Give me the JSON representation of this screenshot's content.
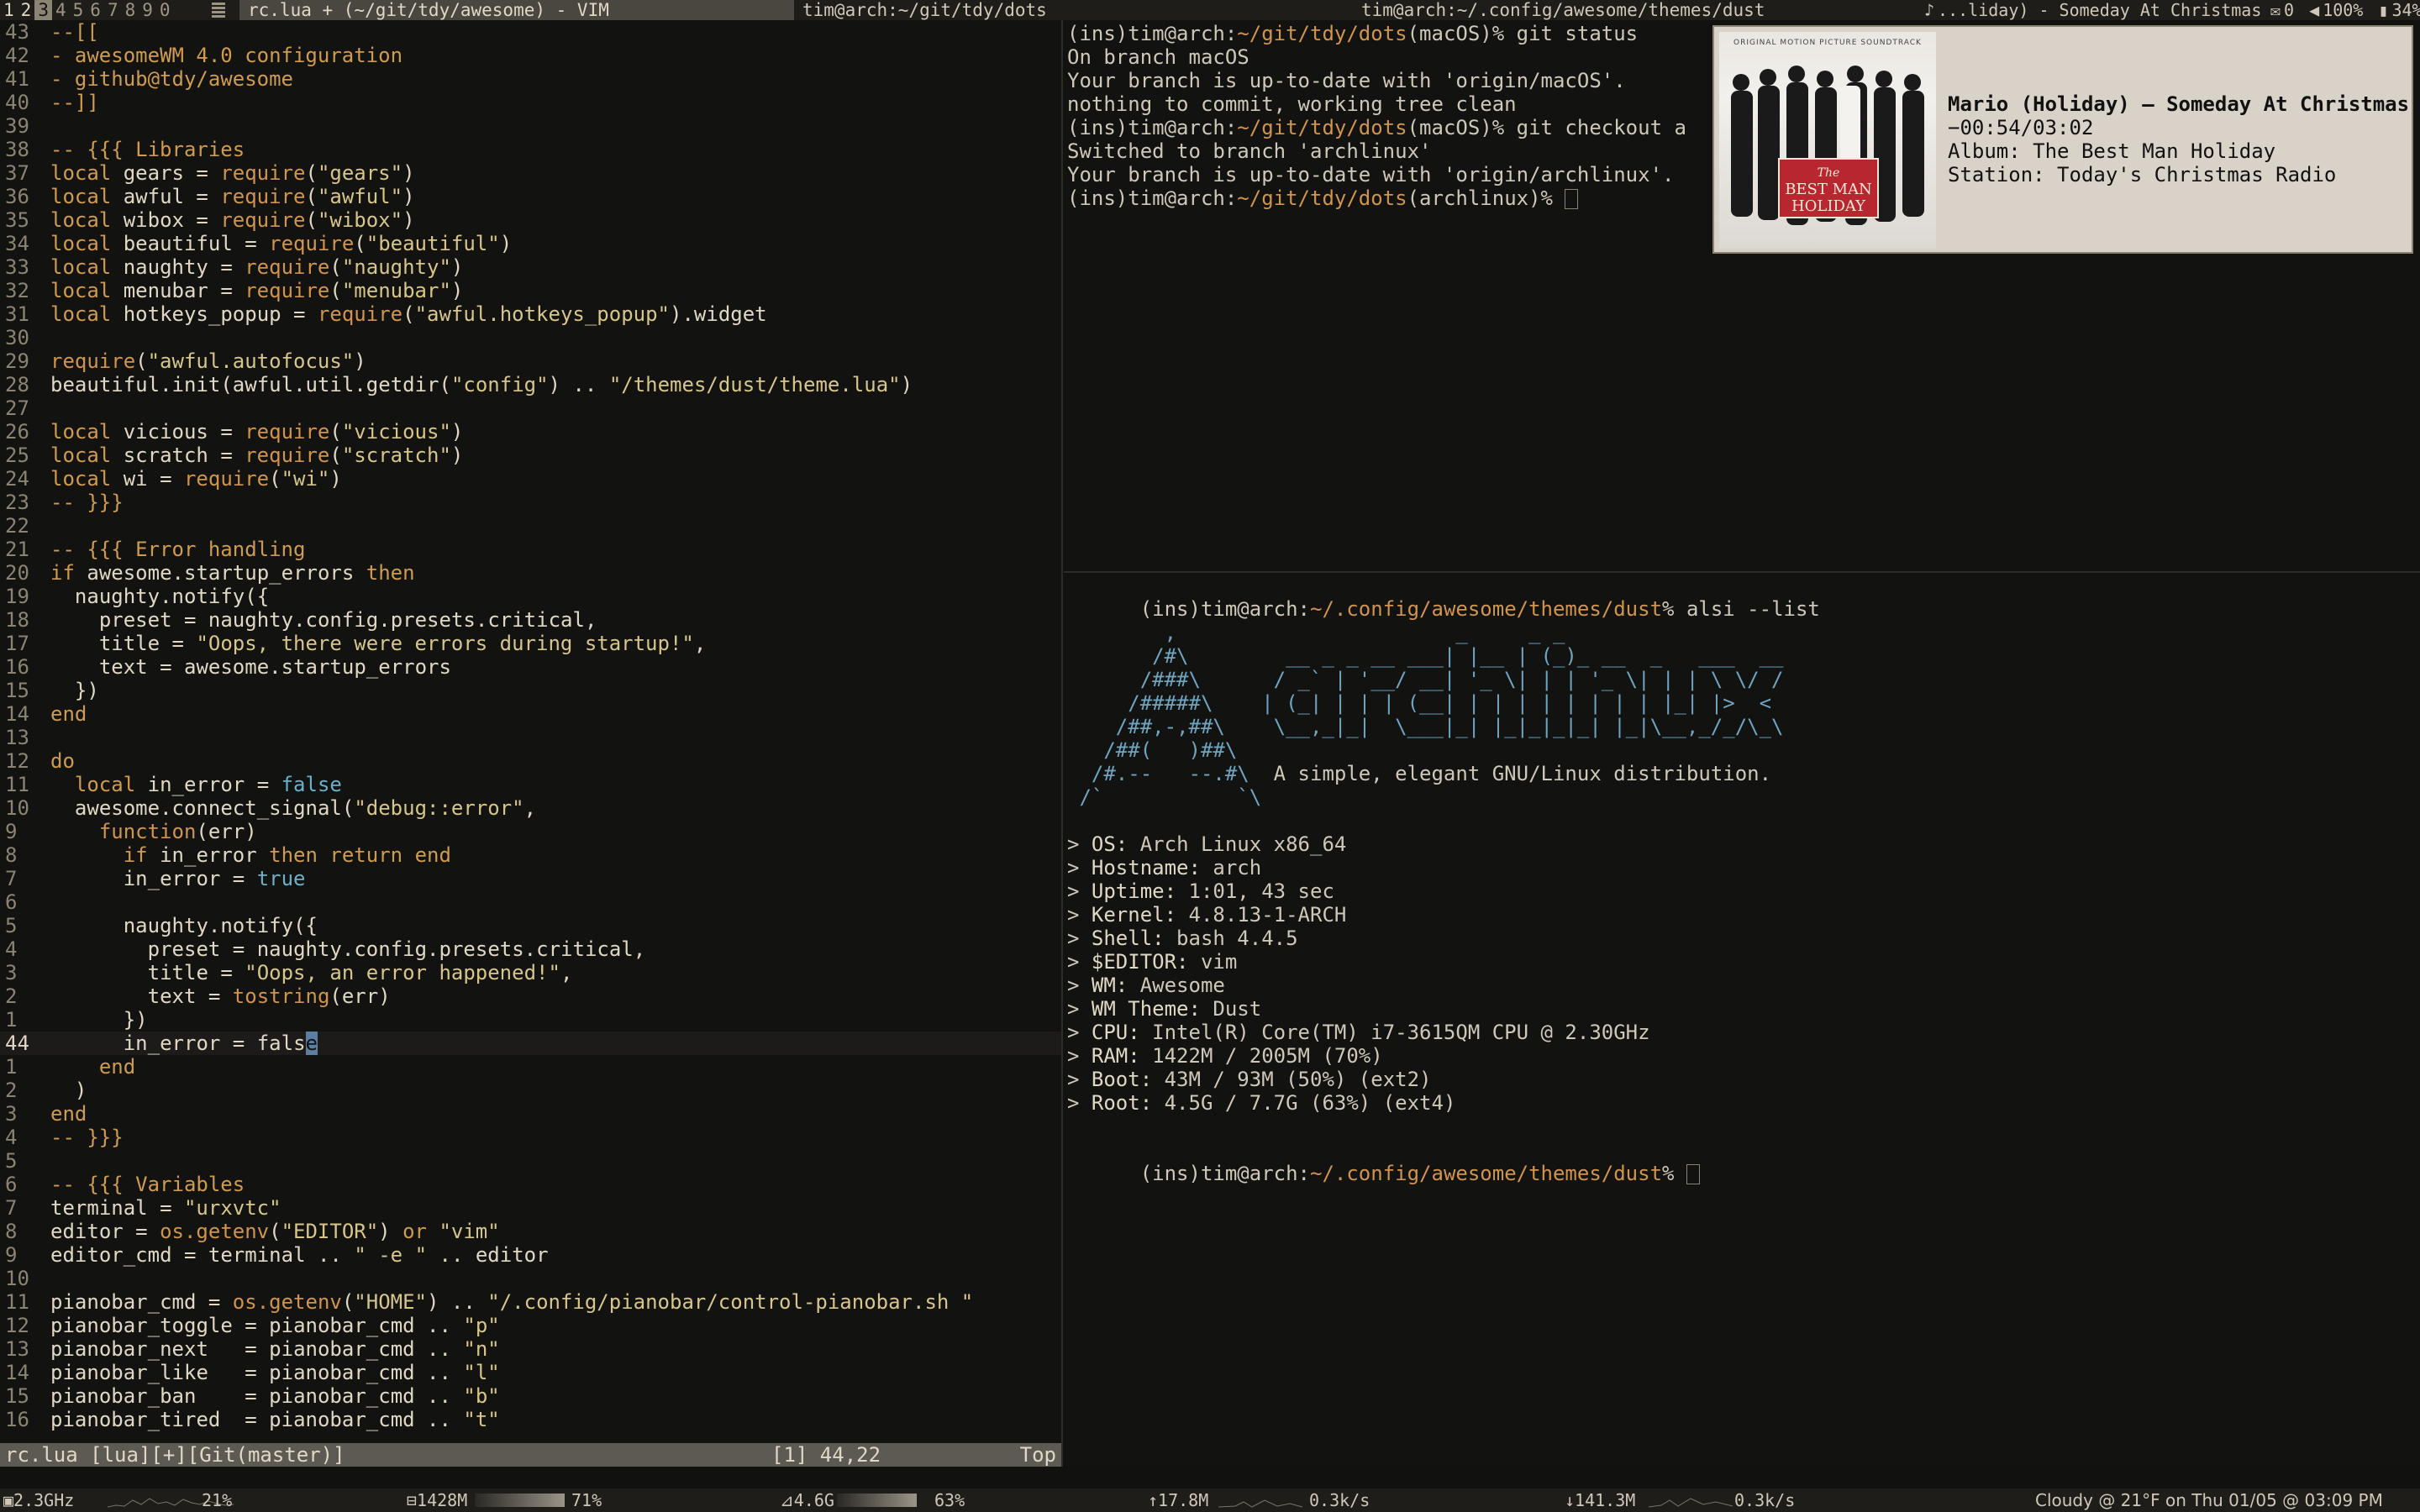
{
  "topbar": {
    "tags": [
      "1",
      "2",
      "3",
      "4",
      "5",
      "6",
      "7",
      "8",
      "9",
      "0"
    ],
    "active_tag": "3",
    "layout_icon": "tile-layout-icon",
    "tasks": [
      {
        "title": "rc.lua + (~/git/tdy/awesome) - VIM",
        "focused": true
      },
      {
        "title": "tim@arch:~/git/tdy/dots",
        "focused": false
      },
      {
        "title": "tim@arch:~/.config/awesome/themes/dust",
        "focused": false
      }
    ],
    "now_playing": "...liday) - Someday At Christmas",
    "mail": "0",
    "volume": "100%",
    "battery": "34%"
  },
  "editor": {
    "lines": [
      {
        "n": "43",
        "t": "--[[",
        "c": "com"
      },
      {
        "n": "42",
        "t": "- awesomeWM 4.0 configuration",
        "c": "com"
      },
      {
        "n": "41",
        "t": "- github@tdy/awesome",
        "c": "com"
      },
      {
        "n": "40",
        "t": "--]]",
        "c": "com"
      },
      {
        "n": "39",
        "t": "",
        "c": "txt"
      },
      {
        "n": "38",
        "t": "-- {{{ Libraries",
        "c": "com"
      },
      {
        "n": "37",
        "t": "local gears = require(\"gears\")",
        "c": "txt"
      },
      {
        "n": "36",
        "t": "local awful = require(\"awful\")",
        "c": "txt"
      },
      {
        "n": "35",
        "t": "local wibox = require(\"wibox\")",
        "c": "txt"
      },
      {
        "n": "34",
        "t": "local beautiful = require(\"beautiful\")",
        "c": "txt"
      },
      {
        "n": "33",
        "t": "local naughty = require(\"naughty\")",
        "c": "txt"
      },
      {
        "n": "32",
        "t": "local menubar = require(\"menubar\")",
        "c": "txt"
      },
      {
        "n": "31",
        "t": "local hotkeys_popup = require(\"awful.hotkeys_popup\").widget",
        "c": "txt"
      },
      {
        "n": "30",
        "t": "",
        "c": "txt"
      },
      {
        "n": "29",
        "t": "require(\"awful.autofocus\")",
        "c": "txt"
      },
      {
        "n": "28",
        "t": "beautiful.init(awful.util.getdir(\"config\") .. \"/themes/dust/theme.lua\")",
        "c": "txt"
      },
      {
        "n": "27",
        "t": "",
        "c": "txt"
      },
      {
        "n": "26",
        "t": "local vicious = require(\"vicious\")",
        "c": "txt"
      },
      {
        "n": "25",
        "t": "local scratch = require(\"scratch\")",
        "c": "txt"
      },
      {
        "n": "24",
        "t": "local wi = require(\"wi\")",
        "c": "txt"
      },
      {
        "n": "23",
        "t": "-- }}}",
        "c": "com"
      },
      {
        "n": "22",
        "t": "",
        "c": "txt"
      },
      {
        "n": "21",
        "t": "-- {{{ Error handling",
        "c": "com"
      },
      {
        "n": "20",
        "t": "if awesome.startup_errors then",
        "c": "txt"
      },
      {
        "n": "19",
        "t": "  naughty.notify({",
        "c": "txt"
      },
      {
        "n": "18",
        "t": "    preset = naughty.config.presets.critical,",
        "c": "txt"
      },
      {
        "n": "17",
        "t": "    title = \"Oops, there were errors during startup!\",",
        "c": "txt"
      },
      {
        "n": "16",
        "t": "    text = awesome.startup_errors",
        "c": "txt"
      },
      {
        "n": "15",
        "t": "  })",
        "c": "txt"
      },
      {
        "n": "14",
        "t": "end",
        "c": "kw"
      },
      {
        "n": "13",
        "t": "",
        "c": "txt"
      },
      {
        "n": "12",
        "t": "do",
        "c": "kw"
      },
      {
        "n": "11",
        "t": "  local in_error = false",
        "c": "txt"
      },
      {
        "n": "10",
        "t": "  awesome.connect_signal(\"debug::error\",",
        "c": "txt"
      },
      {
        "n": "9",
        "t": "    function(err)",
        "c": "txt"
      },
      {
        "n": "8",
        "t": "      if in_error then return end",
        "c": "txt"
      },
      {
        "n": "7",
        "t": "      in_error = true",
        "c": "txt"
      },
      {
        "n": "6",
        "t": "",
        "c": "txt"
      },
      {
        "n": "5",
        "t": "      naughty.notify({",
        "c": "txt"
      },
      {
        "n": "4",
        "t": "        preset = naughty.config.presets.critical,",
        "c": "txt"
      },
      {
        "n": "3",
        "t": "        title = \"Oops, an error happened!\",",
        "c": "txt"
      },
      {
        "n": "2",
        "t": "        text = tostring(err)",
        "c": "txt"
      },
      {
        "n": "1",
        "t": "      })",
        "c": "txt"
      },
      {
        "n": "44",
        "t": "      in_error = fals",
        "c": "txt",
        "current": true,
        "cursor_char": "e"
      },
      {
        "n": "1",
        "t": "    end",
        "c": "kw"
      },
      {
        "n": "2",
        "t": "  )",
        "c": "txt"
      },
      {
        "n": "3",
        "t": "end",
        "c": "kw"
      },
      {
        "n": "4",
        "t": "-- }}}",
        "c": "com"
      },
      {
        "n": "5",
        "t": "",
        "c": "txt"
      },
      {
        "n": "6",
        "t": "-- {{{ Variables",
        "c": "com"
      },
      {
        "n": "7",
        "t": "terminal = \"urxvtc\"",
        "c": "txt"
      },
      {
        "n": "8",
        "t": "editor = os.getenv(\"EDITOR\") or \"vim\"",
        "c": "txt"
      },
      {
        "n": "9",
        "t": "editor_cmd = terminal .. \" -e \" .. editor",
        "c": "txt"
      },
      {
        "n": "10",
        "t": "",
        "c": "txt"
      },
      {
        "n": "11",
        "t": "pianobar_cmd = os.getenv(\"HOME\") .. \"/.config/pianobar/control-pianobar.sh \"",
        "c": "txt"
      },
      {
        "n": "12",
        "t": "pianobar_toggle = pianobar_cmd .. \"p\"",
        "c": "txt"
      },
      {
        "n": "13",
        "t": "pianobar_next   = pianobar_cmd .. \"n\"",
        "c": "txt"
      },
      {
        "n": "14",
        "t": "pianobar_like   = pianobar_cmd .. \"l\"",
        "c": "txt"
      },
      {
        "n": "15",
        "t": "pianobar_ban    = pianobar_cmd .. \"b\"",
        "c": "txt"
      },
      {
        "n": "16",
        "t": "pianobar_tired  = pianobar_cmd .. \"t\"",
        "c": "txt"
      }
    ],
    "statusline_left": "rc.lua [lua][+][Git(master)]",
    "statusline_pos": "[1] 44,22",
    "statusline_scroll": "Top"
  },
  "term1": {
    "lines": [
      {
        "prompt": {
          "ins": "(ins)",
          "user": "tim@arch",
          "sep": ":",
          "path": "~/git/tdy/dots",
          "branch": "(macOS)",
          "sym": "% "
        },
        "cmd": "git status"
      },
      {
        "text": "On branch macOS"
      },
      {
        "text": "Your branch is up-to-date with 'origin/macOS'."
      },
      {
        "text": "nothing to commit, working tree clean"
      },
      {
        "prompt": {
          "ins": "(ins)",
          "user": "tim@arch",
          "sep": ":",
          "path": "~/git/tdy/dots",
          "branch": "(macOS)",
          "sym": "% "
        },
        "cmd": "git checkout a"
      },
      {
        "text": "Switched to branch 'archlinux'"
      },
      {
        "text": "Your branch is up-to-date with 'origin/archlinux'."
      },
      {
        "prompt": {
          "ins": "(ins)",
          "user": "tim@arch",
          "sep": ":",
          "path": "~/git/tdy/dots",
          "branch": "(archlinux)",
          "sym": "% "
        },
        "cmd": "",
        "cursor": true
      }
    ]
  },
  "term2": {
    "prompt1": {
      "ins": "(ins)",
      "user": "tim@arch",
      "sep": ":",
      "path": "~/.config/awesome/themes/dust",
      "sym": "% "
    },
    "cmd1": "alsi --list",
    "ascii_logo": [
      "        ,                       _     _ _",
      "       /#\\        __ _ _ __ ___| |__ | (_)_ __  _   ___  __",
      "      /###\\      / _` | '__/ __| '_ \\| | | '_ \\| | | \\ \\/ /",
      "     /#####\\    | (_| | | | (__| | | | | | | | | |_| |>  <",
      "    /##,-,##\\    \\__,_|_|  \\___|_| |_|_|_|_| |_|\\__,_/_/\\_\\",
      "   /##(   )##\\",
      "  /#.--   --.#\\  A simple, elegant GNU/Linux distribution.",
      " /`           `\\"
    ],
    "info": [
      {
        "k": "OS",
        "v": "Arch Linux x86_64"
      },
      {
        "k": "Hostname",
        "v": "arch"
      },
      {
        "k": "Uptime",
        "v": "1:01, 43 sec"
      },
      {
        "k": "Kernel",
        "v": "4.8.13-1-ARCH"
      },
      {
        "k": "Shell",
        "v": "bash 4.4.5"
      },
      {
        "k": "$EDITOR",
        "v": "vim"
      },
      {
        "k": "WM",
        "v": "Awesome"
      },
      {
        "k": "WM Theme",
        "v": "Dust"
      },
      {
        "k": "CPU",
        "v": "Intel(R) Core(TM) i7-3615QM CPU @ 2.30GHz"
      },
      {
        "k": "RAM",
        "v": "1422M / 2005M (70%)"
      },
      {
        "k": "Boot",
        "v": "43M / 93M (50%) (ext2)"
      },
      {
        "k": "Root",
        "v": "4.5G / 7.7G (63%) (ext4)"
      }
    ],
    "prompt2": {
      "ins": "(ins)",
      "user": "tim@arch",
      "sep": ":",
      "path": "~/.config/awesome/themes/dust",
      "sym": "% "
    }
  },
  "popup": {
    "title": "Mario (Holiday) — Someday At Christmas",
    "time": "−00:54/03:02",
    "album": "Album: The Best Man Holiday",
    "station": "Station: Today's Christmas Radio",
    "cover_text_top": "ORIGINAL MOTION PICTURE SOUNDTRACK",
    "cover_title_1": "The",
    "cover_title_2": "BEST MAN",
    "cover_title_3": "HOLIDAY"
  },
  "bottombar": {
    "cpu_freq": "2.3GHz",
    "cpu_pct": "21%",
    "mem": "1428M",
    "mem_pct": "71%",
    "mem_fill": 0.71,
    "disk": "4.6G",
    "disk_pct": "63%",
    "disk_fill": 0.63,
    "up_total": "17.8M",
    "up_rate": "0.3k/s",
    "down_total": "141.3M",
    "down_rate": "0.3k/s",
    "weather_clock": "Cloudy @ 21°F on Thu 01/05 @ 03:09 PM"
  },
  "colors": {
    "accent": "#d0944c",
    "comment": "#cf9b4f",
    "string": "#d7c58a",
    "bool": "#6ab0c8",
    "arch": "#6fa4c0",
    "popup_bg": "#d8d2c8"
  }
}
